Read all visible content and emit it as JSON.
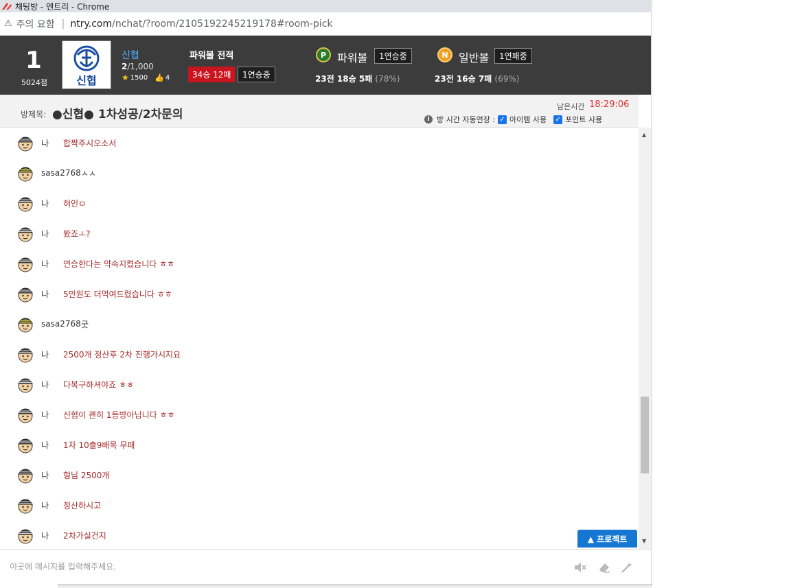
{
  "window": {
    "title": "채팅방 - 엔트리 - Chrome"
  },
  "address": {
    "warning": "주의 요함",
    "url_host": "ntry.com",
    "url_path": "/nchat/?room/2105192245219178#room-pick"
  },
  "header": {
    "rank": "1",
    "points": "5024점",
    "room_name": "신협",
    "members_current": "2",
    "members_total": "/1,000",
    "star_count": "1500",
    "like_count": "4",
    "powerball_title": "파워볼 전적",
    "record_badge": "34승 12패",
    "streak_badge": "1연승중",
    "powerball": {
      "ball": "P",
      "name": "파워볼",
      "streak": "1연승중",
      "record": "23전 18승 5패",
      "pct": "(78%)"
    },
    "normalball": {
      "ball": "N",
      "name": "일반볼",
      "streak": "1연패중",
      "record": "23전 16승 7패",
      "pct": "(69%)"
    }
  },
  "roombar": {
    "label": "방제목:",
    "title": "●신협● 1차성공/2차문의",
    "timer_label": "남은시간",
    "timer": "18:29:06",
    "opt_auto": "방 시간 자동연장 :",
    "opt_item": "아이템 사용",
    "opt_point": "포인트 사용"
  },
  "messages": [
    {
      "user": "나",
      "text": "합짝주시오소서",
      "mine": true
    },
    {
      "user": "sasa2768",
      "text": "ㅅㅅ",
      "mine": false
    },
    {
      "user": "나",
      "text": "혀인ㅁ",
      "mine": true
    },
    {
      "user": "나",
      "text": "봤죠ㅗ?",
      "mine": true
    },
    {
      "user": "나",
      "text": "연승한다는 약속지켰습니다 ㅎㅎ",
      "mine": true
    },
    {
      "user": "나",
      "text": "5만원도 더먹여드렸습니다 ㅎㅎ",
      "mine": true
    },
    {
      "user": "sasa2768",
      "text": "굿",
      "mine": false
    },
    {
      "user": "나",
      "text": "2500개 정산후 2차 진행가시지요",
      "mine": true
    },
    {
      "user": "나",
      "text": "다복구하셔야죠 ㅎㅎ",
      "mine": true
    },
    {
      "user": "나",
      "text": "신협이 괜히 1등방아닙니다 ㅎㅎ",
      "mine": true
    },
    {
      "user": "나",
      "text": "1차 10출9배목 무패",
      "mine": true
    },
    {
      "user": "나",
      "text": "형님 2500개",
      "mine": true
    },
    {
      "user": "나",
      "text": "정산하시고",
      "mine": true
    },
    {
      "user": "나",
      "text": "2차가실건지",
      "mine": true
    }
  ],
  "protect_button": "▲ 프로젝트",
  "input": {
    "placeholder": "이곳에 메시지를 입력해주세요."
  },
  "colors": {
    "header_bg": "#3c3c3c",
    "mine_text": "#a52a2a",
    "accent": "#1677d2",
    "timer": "#e03030"
  },
  "icons": [
    "warning-icon",
    "mute-icon",
    "eraser-icon",
    "magic-wand-icon"
  ]
}
